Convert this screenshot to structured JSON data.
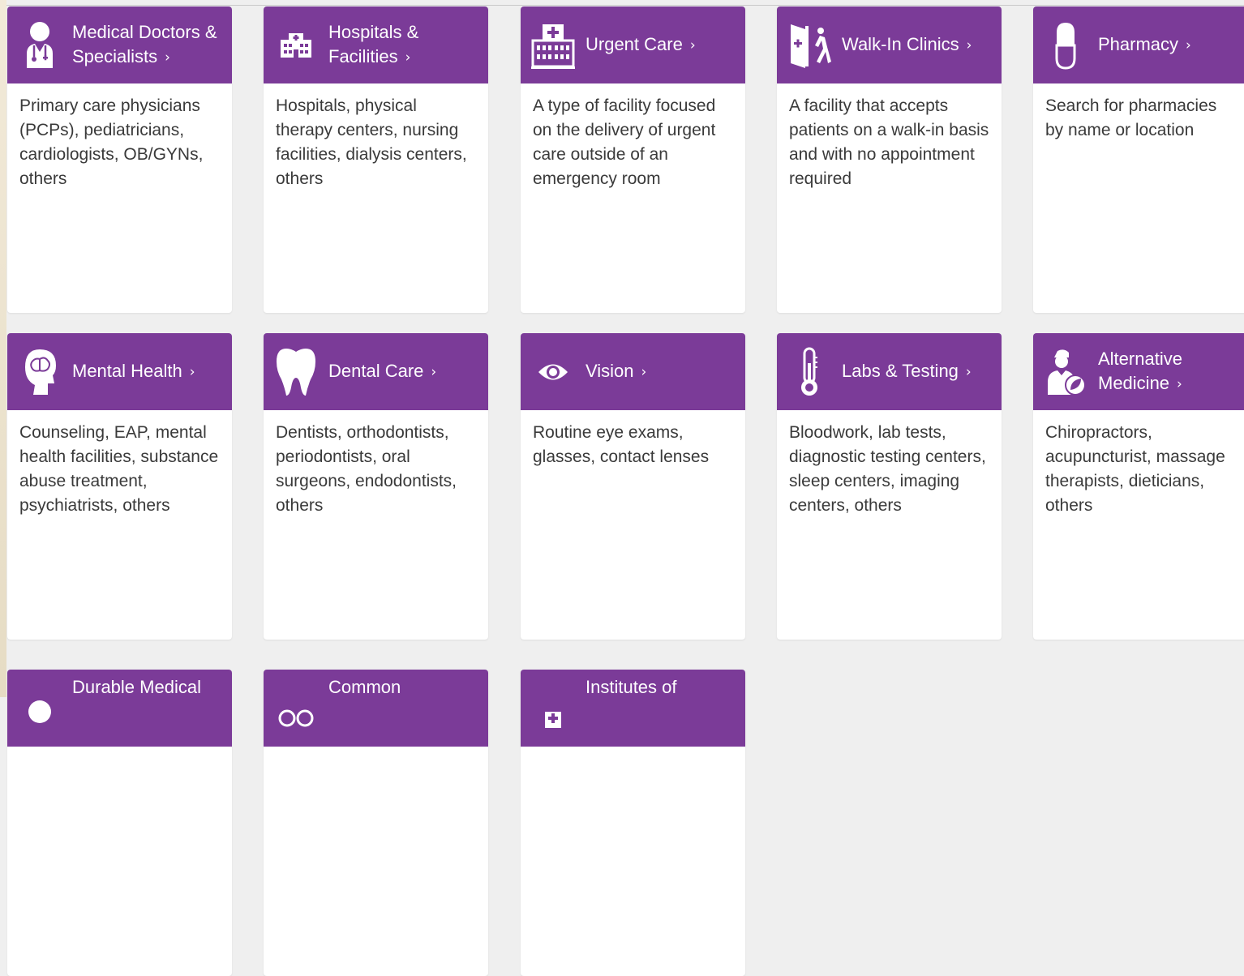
{
  "colors": {
    "header_purple": "#7b3b98",
    "page_background": "#efefef",
    "card_background": "#ffffff",
    "text": "#3a3a3a"
  },
  "cards": [
    {
      "icon": "doctor-icon",
      "title_line1": "Medical Doctors &",
      "title_line2": "Specialists",
      "description": "Primary care physicians (PCPs), pediatricians, cardiologists, OB/GYNs, others"
    },
    {
      "icon": "hospital-icon",
      "title_line1": "Hospitals &",
      "title_line2": "Facilities",
      "description": "Hospitals, physical therapy centers, nursing facilities, dialysis centers, others"
    },
    {
      "icon": "urgent-care-building-icon",
      "title_line1": "Urgent Care",
      "title_line2": "",
      "description": "A type of facility focused on the delivery of urgent care outside of an emergency room"
    },
    {
      "icon": "walk-in-door-icon",
      "title_line1": "Walk-In Clinics",
      "title_line2": "",
      "description": "A facility that accepts patients on a walk-in basis and with no appointment required"
    },
    {
      "icon": "pill-capsule-icon",
      "title_line1": "Pharmacy",
      "title_line2": "",
      "description": "Search for pharmacies by name or location"
    },
    {
      "icon": "head-brain-icon",
      "title_line1": "Mental Health",
      "title_line2": "",
      "description": "Counseling, EAP, mental health facilities, substance abuse treatment, psychiatrists, others"
    },
    {
      "icon": "tooth-icon",
      "title_line1": "Dental Care",
      "title_line2": "",
      "description": "Dentists, orthodontists, periodontists, oral surgeons, endodontists, others"
    },
    {
      "icon": "eye-icon",
      "title_line1": "Vision",
      "title_line2": "",
      "description": "Routine eye exams, glasses, contact lenses"
    },
    {
      "icon": "thermometer-icon",
      "title_line1": "Labs & Testing",
      "title_line2": "",
      "description": "Bloodwork, lab tests, diagnostic testing centers, sleep centers, imaging centers, others"
    },
    {
      "icon": "practitioner-leaf-icon",
      "title_line1": "Alternative",
      "title_line2": "Medicine",
      "description": "Chiropractors, acupuncturist, massage therapists, dieticians, others"
    },
    {
      "icon": "equipment-icon",
      "title_line1": "Durable Medical",
      "title_line2": "",
      "description": ""
    },
    {
      "icon": "glasses-icon",
      "title_line1": "Common",
      "title_line2": "",
      "description": ""
    },
    {
      "icon": "plus-icon",
      "title_line1": "Institutes of",
      "title_line2": "",
      "description": ""
    }
  ]
}
